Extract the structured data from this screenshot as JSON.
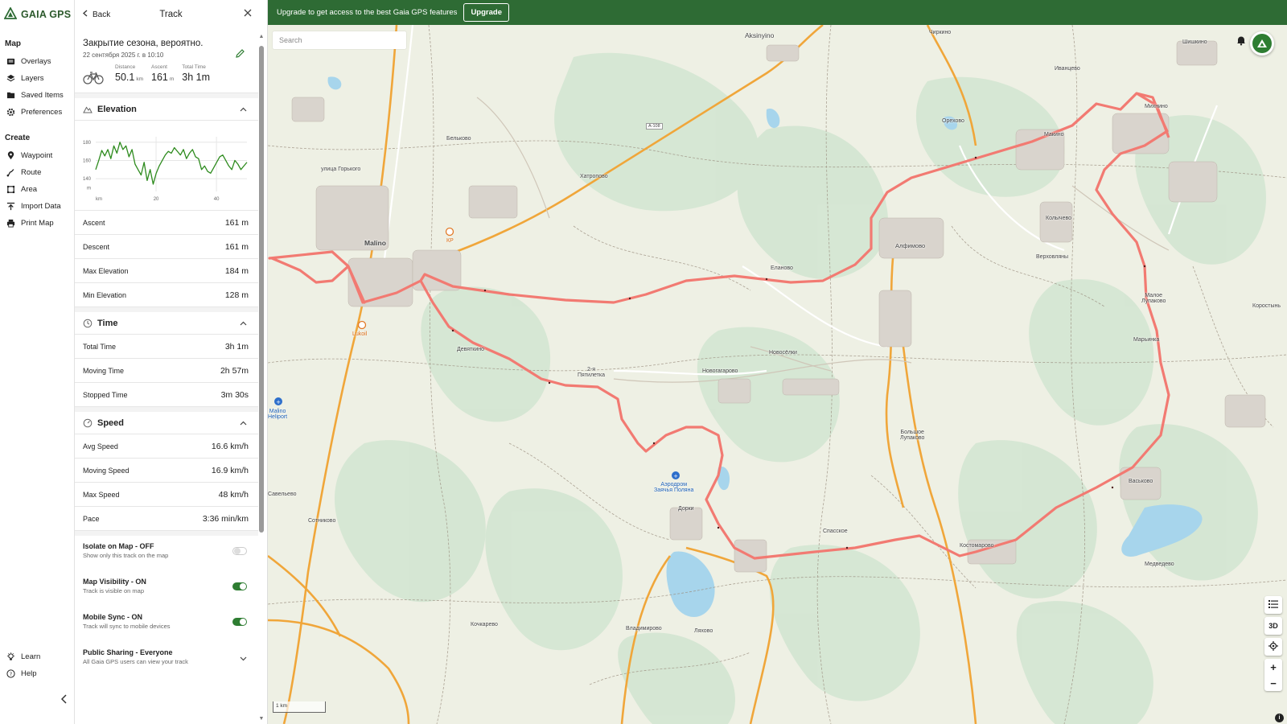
{
  "app": {
    "name": "GAIA GPS"
  },
  "nav": {
    "map_section": "Map",
    "map_items": [
      {
        "label": "Overlays",
        "icon": "overlays-icon"
      },
      {
        "label": "Layers",
        "icon": "layers-icon"
      },
      {
        "label": "Saved Items",
        "icon": "saved-items-icon"
      },
      {
        "label": "Preferences",
        "icon": "gear-icon"
      }
    ],
    "create_section": "Create",
    "create_items": [
      {
        "label": "Waypoint",
        "icon": "waypoint-icon"
      },
      {
        "label": "Route",
        "icon": "route-icon"
      },
      {
        "label": "Area",
        "icon": "area-icon"
      },
      {
        "label": "Import Data",
        "icon": "import-icon"
      },
      {
        "label": "Print Map",
        "icon": "print-icon"
      }
    ],
    "bottom_items": [
      {
        "label": "Learn",
        "icon": "lightbulb-icon"
      },
      {
        "label": "Help",
        "icon": "help-icon"
      }
    ]
  },
  "panel": {
    "back_label": "Back",
    "title": "Track",
    "track_name": "Закрытие сезона, вероятно.",
    "track_date": "22 сентября 2025 г. в 10:10",
    "summary": {
      "distance_label": "Distance",
      "distance_value": "50.1",
      "distance_unit": "km",
      "ascent_label": "Ascent",
      "ascent_value": "161",
      "ascent_unit": "m",
      "time_label": "Total Time",
      "time_value": "3h 1m"
    },
    "elevation": {
      "title": "Elevation",
      "stats": [
        {
          "label": "Ascent",
          "value": "161 m"
        },
        {
          "label": "Descent",
          "value": "161 m"
        },
        {
          "label": "Max Elevation",
          "value": "184 m"
        },
        {
          "label": "Min Elevation",
          "value": "128 m"
        }
      ]
    },
    "time": {
      "title": "Time",
      "stats": [
        {
          "label": "Total Time",
          "value": "3h 1m"
        },
        {
          "label": "Moving Time",
          "value": "2h 57m"
        },
        {
          "label": "Stopped Time",
          "value": "3m 30s"
        }
      ]
    },
    "speed": {
      "title": "Speed",
      "stats": [
        {
          "label": "Avg Speed",
          "value": "16.6 km/h"
        },
        {
          "label": "Moving Speed",
          "value": "16.9 km/h"
        },
        {
          "label": "Max Speed",
          "value": "48 km/h"
        },
        {
          "label": "Pace",
          "value": "3:36 min/km"
        }
      ]
    },
    "toggles": [
      {
        "title": "Isolate on Map - OFF",
        "sub": "Show only this track on the map",
        "state": "off"
      },
      {
        "title": "Map Visibility - ON",
        "sub": "Track is visible on map",
        "state": "on"
      },
      {
        "title": "Mobile Sync - ON",
        "sub": "Track will sync to mobile devices",
        "state": "on"
      }
    ],
    "sharing": {
      "title": "Public Sharing - Everyone",
      "sub": "All Gaia GPS users can view your track"
    }
  },
  "chart_data": {
    "type": "line",
    "title": "",
    "xlabel": "km",
    "ylabel": "m",
    "x_ticks": [
      "20",
      "40"
    ],
    "y_ticks": [
      "180",
      "160",
      "140"
    ],
    "xlim": [
      0,
      50.1
    ],
    "ylim": [
      126,
      186
    ],
    "color": "#2e8b1e",
    "x": [
      0,
      1,
      2,
      3,
      4,
      5,
      6,
      7,
      8,
      9,
      10,
      11,
      12,
      13,
      14,
      15,
      16,
      17,
      18,
      19,
      20,
      21,
      22,
      23,
      24,
      25,
      26,
      27,
      28,
      29,
      30,
      31,
      32,
      33,
      34,
      35,
      36,
      37,
      38,
      39,
      40,
      41,
      42,
      43,
      44,
      45,
      46,
      47,
      48,
      49,
      50
    ],
    "values": [
      150,
      160,
      171,
      165,
      172,
      162,
      176,
      168,
      180,
      172,
      176,
      164,
      172,
      156,
      150,
      144,
      158,
      138,
      150,
      134,
      146,
      154,
      160,
      166,
      170,
      168,
      174,
      170,
      166,
      172,
      162,
      168,
      172,
      164,
      162,
      150,
      154,
      148,
      146,
      152,
      158,
      164,
      166,
      160,
      154,
      150,
      160,
      156,
      150,
      154,
      158
    ]
  },
  "banner": {
    "text": "Upgrade to get access to the best Gaia GPS features",
    "button": "Upgrade"
  },
  "map": {
    "search_placeholder": "Search",
    "scale_label": "1 km",
    "controls": [
      "3D",
      "+",
      "−"
    ],
    "labels": {
      "malino": "Malino",
      "aksinyino": "Aksinyino",
      "alfimovo": "Алфимово",
      "novogavrovo": "Новогагарово",
      "devyatkino": "Девяткино",
      "heliport": "Malino\nHeliport",
      "lukoil": "Lukoil",
      "airfield": "Аэродром\nЗаячья Поляна",
      "kostomarovo": "Костомарово",
      "spasskoe": "Спасское",
      "dorki": "Дорки",
      "vladimirovo": "Владимирово",
      "lyakhovo": "Ляхово",
      "kochkarevo": "Кочкарево",
      "sotnikovo": "Сотниково",
      "savelyevo": "Савельево",
      "maykino": "Макино",
      "ivantsevo": "Иванцево",
      "orekhovo": "Орехово",
      "mikhnino": "Михнино",
      "kolychevo": "Колычево",
      "elganovo": "Еланово",
      "novoselki": "Новосёлки",
      "bolshoe_lupakovo": "Большое\nЛупаково",
      "maloe_lupakovo": "Малое\nЛупаково",
      "marinkina": "Марьинка",
      "vaskovo": "Васьково",
      "medvedevo": "Медведево",
      "verkhovlyany": "Верховляны",
      "staroe_pyatilетka": "2-я\nПятилетка",
      "korostyn": "Коростынь",
      "khatropovo": "Хатропово",
      "belkovo": "Бельково",
      "chirkino": "Чиркино",
      "shishkino": "Шишкино",
      "ulitsa_gorkogo": "улица Горького",
      "kp": "КР",
      "a108": "A-108"
    }
  },
  "colors": {
    "brand_green": "#2e6b34",
    "track_red": "#f06464",
    "road_orange": "#f2a93b",
    "water_blue": "#9fd1ea",
    "forest": "#cfe3cf"
  }
}
